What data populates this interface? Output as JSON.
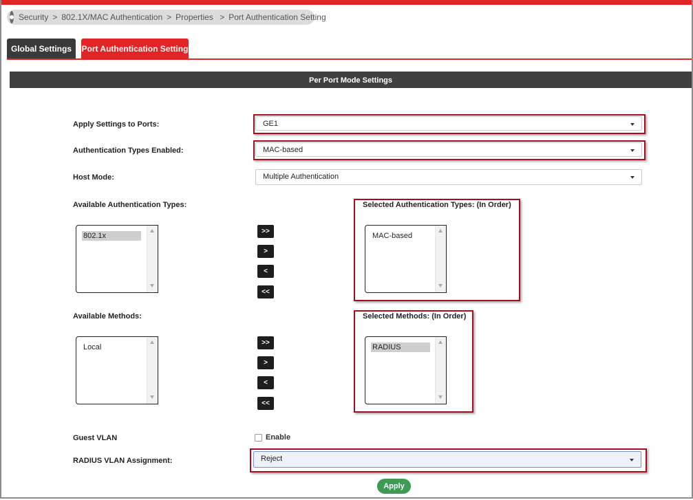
{
  "breadcrumb": [
    "Security",
    "802.1X/MAC Authentication",
    "Properties ",
    "Port Authentication Setting"
  ],
  "breadcrumb_separator": ">",
  "tabs": [
    {
      "label": "Global Settings",
      "active": false
    },
    {
      "label": "Port Authentication Setting",
      "active": true
    }
  ],
  "section_title": "Per Port Mode Settings",
  "fields": {
    "apply_ports": {
      "label": "Apply Settings to Ports:",
      "value": "GE1"
    },
    "auth_types_enabled": {
      "label": "Authentication Types Enabled:",
      "value": "MAC-based"
    },
    "host_mode": {
      "label": "Host Mode:",
      "value": "Multiple Authentication"
    },
    "available_auth_types": {
      "label": "Available Authentication Types:",
      "items": [
        "802.1x"
      ]
    },
    "selected_auth_types": {
      "label": "Selected Authentication Types: (In Order)",
      "items": [
        "MAC-based"
      ]
    },
    "available_methods": {
      "label": "Available Methods:",
      "items": [
        "Local"
      ]
    },
    "selected_methods": {
      "label": "Selected Methods: (In Order)",
      "items": [
        "RADIUS"
      ]
    },
    "guest_vlan": {
      "label": "Guest VLAN",
      "checkbox_label": "Enable",
      "checked": false
    },
    "radius_vlan": {
      "label": "RADIUS VLAN Assignment:",
      "value": "Reject"
    }
  },
  "move_buttons": {
    "add_all": ">>",
    "add": ">",
    "remove": "<",
    "remove_all": "<<"
  },
  "apply_label": "Apply",
  "colors": {
    "accent_red": "#e32424",
    "dark_header": "#404040",
    "highlight_box": "#a50f1d",
    "apply_green": "#3e9a55"
  },
  "icons": {
    "breadcrumb": "location-pin-icon",
    "dropdown": "caret-down-icon"
  }
}
